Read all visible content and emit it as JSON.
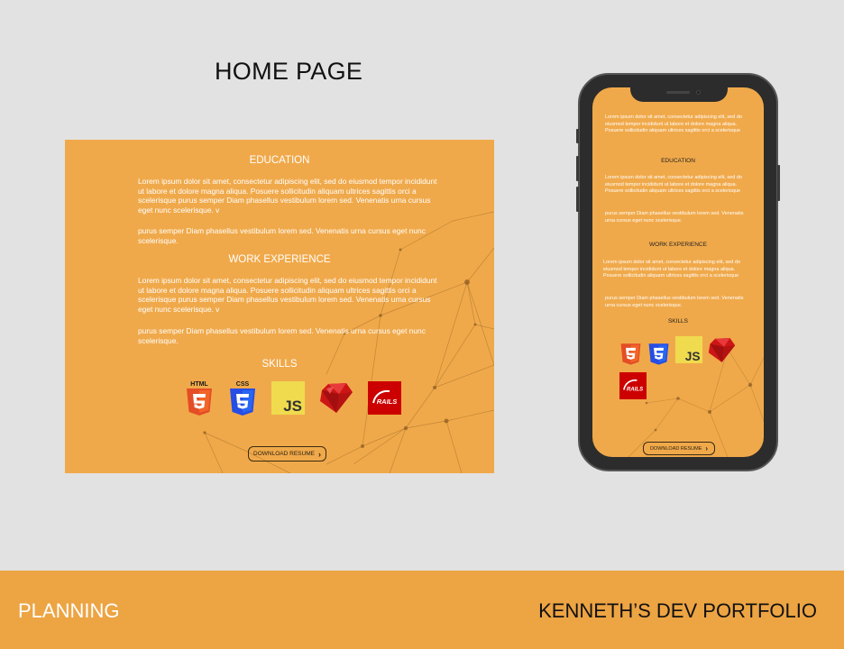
{
  "heading": "HOME PAGE",
  "desktop": {
    "education_title": "EDUCATION",
    "education_p1": "Lorem ipsum dolor sit amet, consectetur adipiscing elit, sed do eiusmod tempor incididunt ut labore et dolore magna aliqua. Posuere sollicitudin aliquam ultrices sagittis orci a scelerisque purus semper Diam phasellus vestibulum lorem sed. Venenatis urna cursus eget nunc scelerisque. v",
    "education_p2": "purus semper Diam phasellus vestibulum lorem sed. Venenatis urna cursus eget nunc scelerisque.",
    "work_title": "WORK EXPERIENCE",
    "work_p1": "Lorem ipsum dolor sit amet, consectetur adipiscing elit, sed do eiusmod tempor incididunt ut labore et dolore magna aliqua. Posuere sollicitudin aliquam ultrices sagittis orci a scelerisque purus semper Diam phasellus vestibulum lorem sed. Venenatis urna cursus eget nunc scelerisque. v",
    "work_p2": "purus semper Diam phasellus vestibulum lorem sed. Venenatis urna cursus eget nunc scelerisque.",
    "skills_title": "SKILLS",
    "download_label": "DOWNLOAD RESUME"
  },
  "mobile": {
    "intro": "Lorem ipsum dolor sit amet, consectetur adipiscing elit, sed do eiusmod tempor incididunt ut labore et dolore magna aliqua. Posuere sollicitudin aliquam ultrices sagittis orci a scelerisque",
    "education_title": "EDUCATION",
    "education_p1": "Lorem ipsum dolor sit amet, consectetur adipiscing elit, sed do eiusmod tempor incididunt ut labore et dolore magna aliqua. Posuere sollicitudin aliquam ultrices sagittis orci a scelerisque",
    "education_p2": "purus semper Diam phasellus vestibulum lorem sed. Venenatis urna cursus eget nunc scelerisque.",
    "work_title": "WORK EXPERIENCE",
    "work_p1": "Lorem ipsum dolor sit amet, consectetur adipiscing elit, sed do eiusmod tempor incididunt ut labore et dolore magna aliqua. Posuere sollicitudin aliquam ultrices sagittis orci a scelerisque",
    "work_p2": "purus semper Diam phasellus vestibulum lorem sed. Venenatis urna cursus eget nunc scelerisque.",
    "skills_title": "SKILLS",
    "download_label": "DOWNLOAD RESUME"
  },
  "skills_icons": {
    "html5": "HTML",
    "css3": "CSS",
    "js": "JS",
    "rails": "RAILS"
  },
  "footer": {
    "left": "PLANNING",
    "right": "KENNETH’S DEV PORTFOLIO"
  },
  "colors": {
    "accent": "#f0a94a",
    "footer": "#eda443",
    "background": "#e2e2e2"
  }
}
